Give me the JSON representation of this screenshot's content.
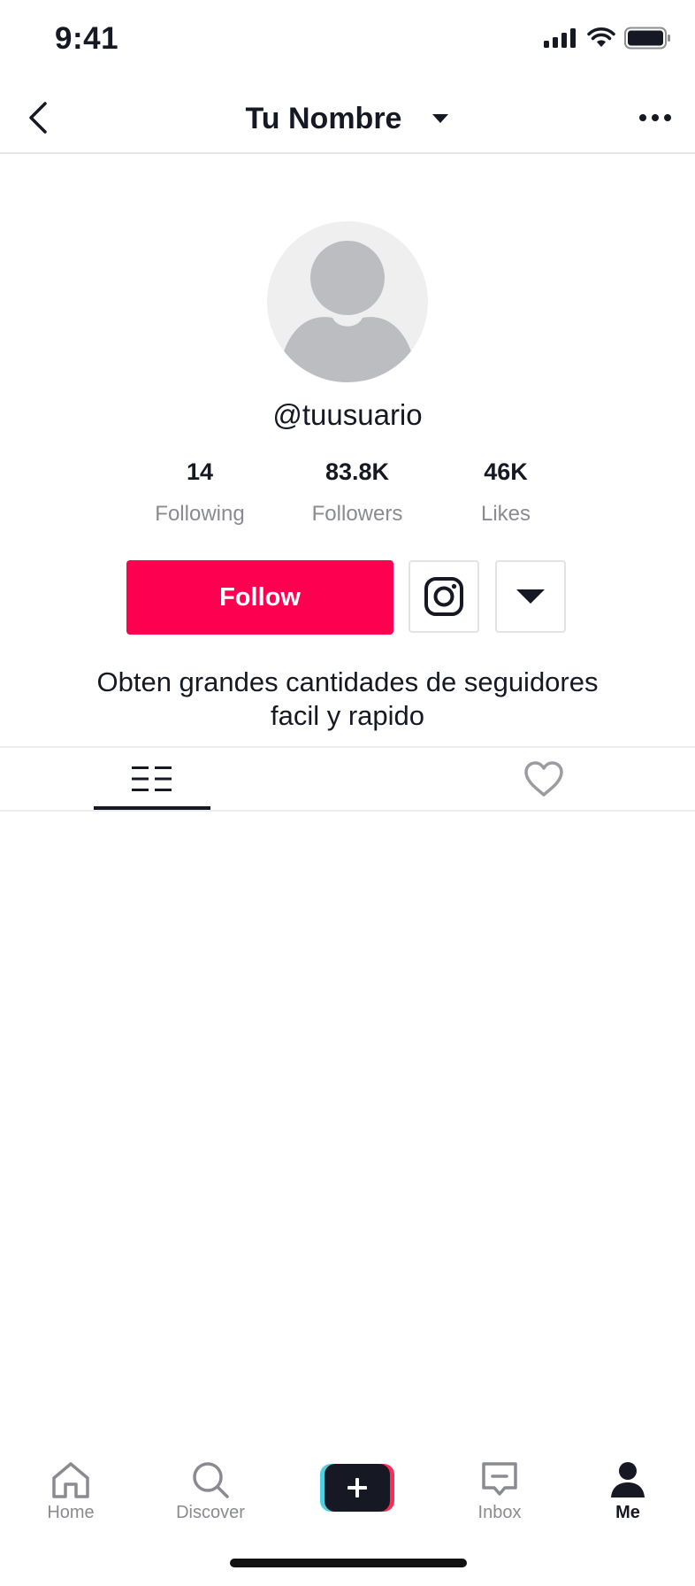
{
  "status_bar": {
    "time": "9:41"
  },
  "header": {
    "title": "Tu Nombre"
  },
  "profile": {
    "username": "@tuusuario",
    "stats": [
      {
        "value": "14",
        "label": "Following"
      },
      {
        "value": "83.8K",
        "label": "Followers"
      },
      {
        "value": "46K",
        "label": "Likes"
      }
    ],
    "follow_label": "Follow",
    "bio_line1": "Obten grandes cantidades de seguidores",
    "bio_line2": "facil y rapido"
  },
  "bottom_nav": {
    "items": [
      {
        "label": "Home",
        "icon": "home-icon"
      },
      {
        "label": "Discover",
        "icon": "search-icon"
      },
      {
        "label": "",
        "icon": "plus-icon"
      },
      {
        "label": "Inbox",
        "icon": "inbox-icon"
      },
      {
        "label": "Me",
        "icon": "profile-icon"
      }
    ]
  },
  "colors": {
    "accent": "#fe0050",
    "text": "#161823",
    "muted": "#8a8b91"
  }
}
